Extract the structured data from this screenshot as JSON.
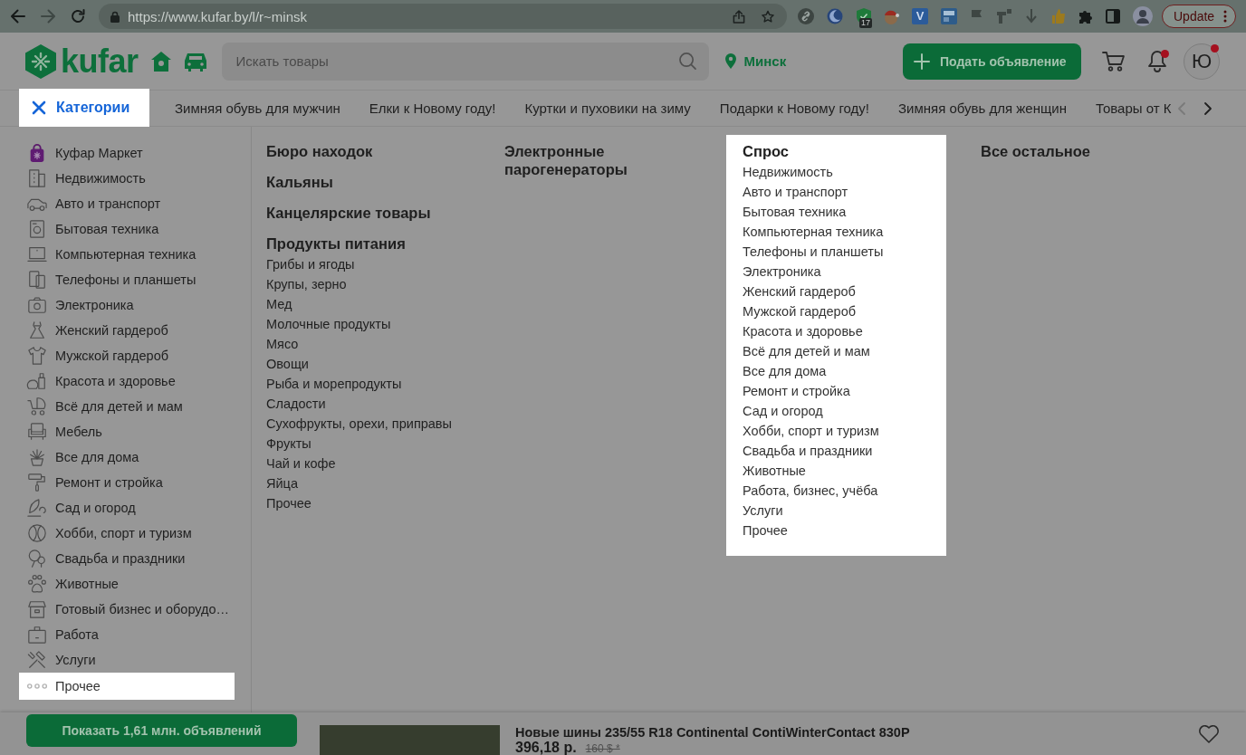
{
  "browser": {
    "url": "https://www.kufar.by/l/r~minsk",
    "extension_letter": "V",
    "extension_badge": "17",
    "update_button": "Update"
  },
  "header": {
    "logo": "kufar",
    "search": {
      "placeholder": "Искать товары"
    },
    "location": "Минск",
    "post_button": "Подать объявление",
    "notifications": {
      "unread": true
    },
    "avatar": {
      "initial": "Ю",
      "badge": true
    }
  },
  "nav": {
    "categories_button": {
      "label": "Категории",
      "highlighted": true
    },
    "links": [
      "Зимняя обувь для мужчин",
      "Елки к Новому году!",
      "Куртки и пуховики на зиму",
      "Подарки к Новому году!",
      "Зимняя обувь для женщин",
      "Товары от К"
    ],
    "prev_enabled": false,
    "next_enabled": true
  },
  "sidebar": {
    "items": [
      {
        "label": "Куфар Маркет",
        "highlighted": false
      },
      {
        "label": "Недвижимость",
        "highlighted": false
      },
      {
        "label": "Авто и транспорт",
        "highlighted": false
      },
      {
        "label": "Бытовая техника",
        "highlighted": false
      },
      {
        "label": "Компьютерная техника",
        "highlighted": false
      },
      {
        "label": "Телефоны и планшеты",
        "highlighted": false
      },
      {
        "label": "Электроника",
        "highlighted": false
      },
      {
        "label": "Женский гардероб",
        "highlighted": false
      },
      {
        "label": "Мужской гардероб",
        "highlighted": false
      },
      {
        "label": "Красота и здоровье",
        "highlighted": false
      },
      {
        "label": "Всё для детей и мам",
        "highlighted": false
      },
      {
        "label": "Мебель",
        "highlighted": false
      },
      {
        "label": "Все для дома",
        "highlighted": false
      },
      {
        "label": "Ремонт и стройка",
        "highlighted": false
      },
      {
        "label": "Сад и огород",
        "highlighted": false
      },
      {
        "label": "Хобби, спорт и туризм",
        "highlighted": false
      },
      {
        "label": "Свадьба и праздники",
        "highlighted": false
      },
      {
        "label": "Животные",
        "highlighted": false
      },
      {
        "label": "Готовый бизнес и оборудо…",
        "highlighted": false
      },
      {
        "label": "Работа",
        "highlighted": false
      },
      {
        "label": "Услуги",
        "highlighted": false
      },
      {
        "label": "Прочее",
        "highlighted": true
      }
    ]
  },
  "catalog": {
    "columns": [
      {
        "highlighted": false,
        "groups": [
          {
            "title": "Бюро находок"
          },
          {
            "title": "Кальяны"
          },
          {
            "title": "Канцелярские товары"
          },
          {
            "title": "Продукты питания",
            "items": [
              "Грибы и ягоды",
              "Крупы, зерно",
              "Мед",
              "Молочные продукты",
              "Мясо",
              "Овощи",
              "Рыба и морепродукты",
              "Сладости",
              "Сухофрукты, орехи, приправы",
              "Фрукты",
              "Чай и кофе",
              "Яйца",
              "Прочее"
            ]
          }
        ]
      },
      {
        "highlighted": false,
        "groups": [
          {
            "title": "Электронные парогенераторы"
          }
        ]
      },
      {
        "highlighted": true,
        "groups": [
          {
            "title": "Спрос",
            "items": [
              "Недвижимость",
              "Авто и транспорт",
              "Бытовая техника",
              "Компьютерная техника",
              "Телефоны и планшеты",
              "Электроника",
              "Женский гардероб",
              "Мужской гардероб",
              "Красота и здоровье",
              "Всё для детей и мам",
              "Все для дома",
              "Ремонт и стройка",
              "Сад и огород",
              "Хобби, спорт и туризм",
              "Свадьба и праздники",
              "Животные",
              "Работа, бизнес, учёба",
              "Услуги",
              "Прочее"
            ]
          }
        ]
      },
      {
        "highlighted": false,
        "groups": [
          {
            "title": "Все остальное"
          }
        ]
      }
    ]
  },
  "footer": {
    "show_button": "Показать 1,61 млн. объявлений",
    "listing": {
      "title": "Новые шины 235/55 R18 Continental ContiWinterContact 830P",
      "price": "396,18 р.",
      "old_price": "160 $ *"
    }
  }
}
